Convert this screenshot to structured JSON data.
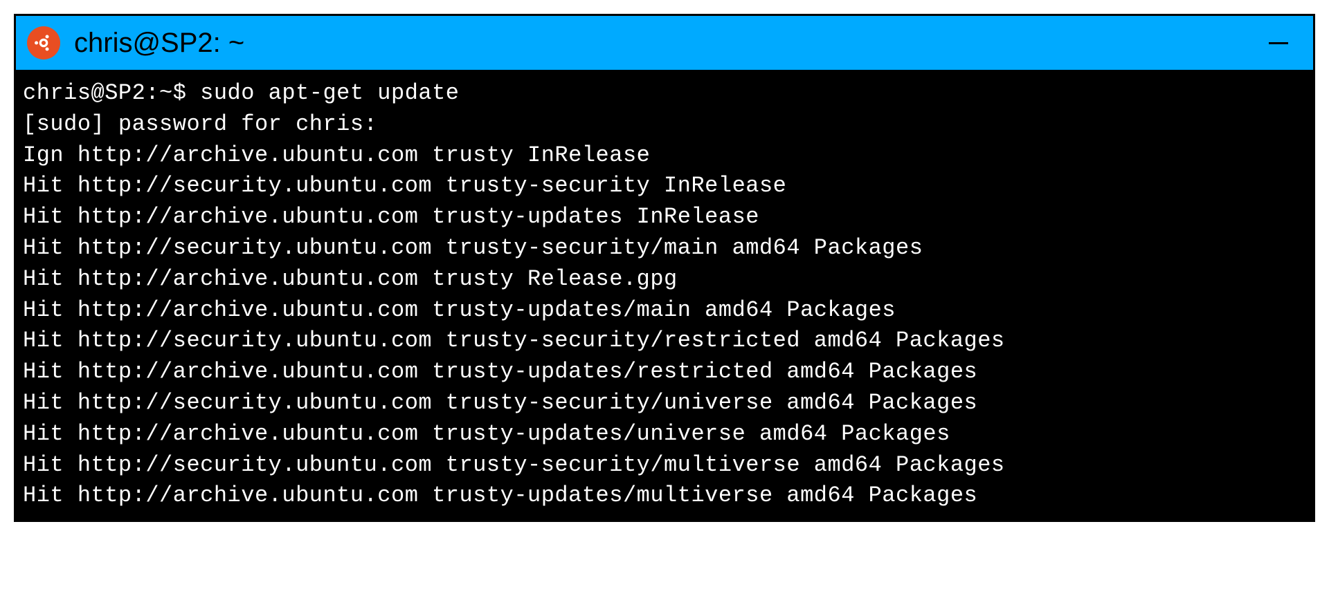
{
  "titlebar": {
    "title": "chris@SP2: ~"
  },
  "terminal": {
    "prompt": "chris@SP2:~$",
    "command": "sudo apt-get update",
    "lines": [
      "[sudo] password for chris:",
      "Ign http://archive.ubuntu.com trusty InRelease",
      "Hit http://security.ubuntu.com trusty-security InRelease",
      "Hit http://archive.ubuntu.com trusty-updates InRelease",
      "Hit http://security.ubuntu.com trusty-security/main amd64 Packages",
      "Hit http://archive.ubuntu.com trusty Release.gpg",
      "Hit http://archive.ubuntu.com trusty-updates/main amd64 Packages",
      "Hit http://security.ubuntu.com trusty-security/restricted amd64 Packages",
      "Hit http://archive.ubuntu.com trusty-updates/restricted amd64 Packages",
      "Hit http://security.ubuntu.com trusty-security/universe amd64 Packages",
      "Hit http://archive.ubuntu.com trusty-updates/universe amd64 Packages",
      "Hit http://security.ubuntu.com trusty-security/multiverse amd64 Packages",
      "Hit http://archive.ubuntu.com trusty-updates/multiverse amd64 Packages"
    ]
  }
}
